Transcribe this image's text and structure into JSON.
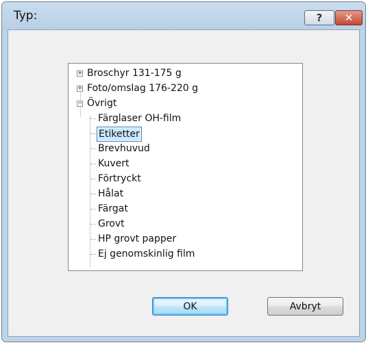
{
  "dialog": {
    "title": "Typ:",
    "help_icon": "?",
    "close_icon": "✕"
  },
  "tree": {
    "items": [
      {
        "label": "Broschyr 131-175 g",
        "expander": "+"
      },
      {
        "label": "Foto/omslag 176-220 g",
        "expander": "+"
      },
      {
        "label": "Övrigt",
        "expander": "−"
      },
      {
        "label": "Färglaser OH-film"
      },
      {
        "label": "Etiketter",
        "selected": true
      },
      {
        "label": "Brevhuvud"
      },
      {
        "label": "Kuvert"
      },
      {
        "label": "Förtryckt"
      },
      {
        "label": "Hålat"
      },
      {
        "label": "Färgat"
      },
      {
        "label": "Grovt"
      },
      {
        "label": "HP grovt papper"
      },
      {
        "label": "Ej genomskinlig film"
      }
    ]
  },
  "scrollbar": {
    "up": "▲",
    "down": "▼"
  },
  "buttons": {
    "ok": "OK",
    "cancel": "Avbryt"
  }
}
